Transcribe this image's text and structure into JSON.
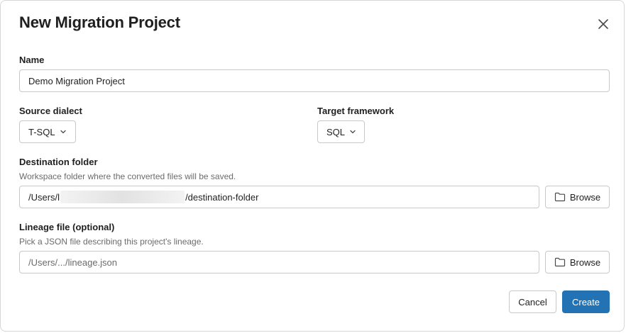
{
  "dialog": {
    "title": "New Migration Project"
  },
  "name": {
    "label": "Name",
    "value": "Demo Migration Project"
  },
  "source_dialect": {
    "label": "Source dialect",
    "value": "T-SQL"
  },
  "target_framework": {
    "label": "Target framework",
    "value": "SQL"
  },
  "destination_folder": {
    "label": "Destination folder",
    "hint": "Workspace folder where the converted files will be saved.",
    "path_prefix": "/Users/l",
    "path_suffix": "/destination-folder",
    "browse_label": "Browse"
  },
  "lineage_file": {
    "label": "Lineage file (optional)",
    "hint": "Pick a JSON file describing this project's lineage.",
    "placeholder": "/Users/.../lineage.json",
    "browse_label": "Browse"
  },
  "footer": {
    "cancel_label": "Cancel",
    "create_label": "Create"
  },
  "icons": {
    "close": "close-icon",
    "chevron": "chevron-down-icon",
    "folder": "folder-icon"
  },
  "colors": {
    "primary": "#2272b4",
    "border": "#c8c8c8",
    "hint_text": "#6b6b6b"
  }
}
